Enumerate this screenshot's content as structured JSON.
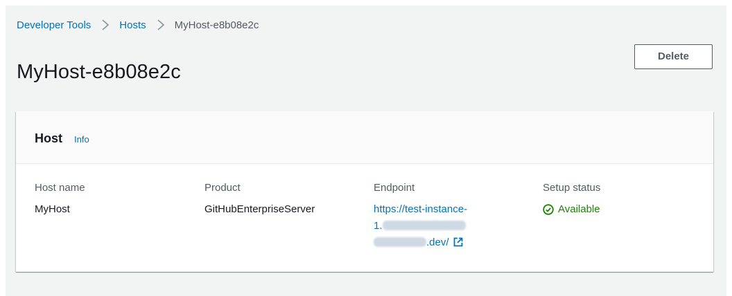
{
  "breadcrumb": {
    "items": [
      {
        "label": "Developer Tools"
      },
      {
        "label": "Hosts"
      },
      {
        "label": "MyHost-e8b08e2c"
      }
    ]
  },
  "header": {
    "title": "MyHost-e8b08e2c",
    "delete_label": "Delete"
  },
  "panel": {
    "title": "Host",
    "info_label": "Info",
    "columns": {
      "host_name": {
        "label": "Host name",
        "value": "MyHost"
      },
      "product": {
        "label": "Product",
        "value": "GitHubEnterpriseServer"
      },
      "endpoint": {
        "label": "Endpoint",
        "line1": "https://test-instance-",
        "line2": "1.",
        "line3": ".dev/"
      },
      "setup_status": {
        "label": "Setup status",
        "value": "Available"
      }
    }
  },
  "icons": {
    "breadcrumb_separator": "chevron-right-icon",
    "endpoint_external": "external-link-icon",
    "status": "check-circle-icon"
  },
  "colors": {
    "link": "#0073bb",
    "success": "#1d8102",
    "text": "#16191f",
    "secondary_text": "#545b64",
    "background": "#f2f3f3"
  }
}
